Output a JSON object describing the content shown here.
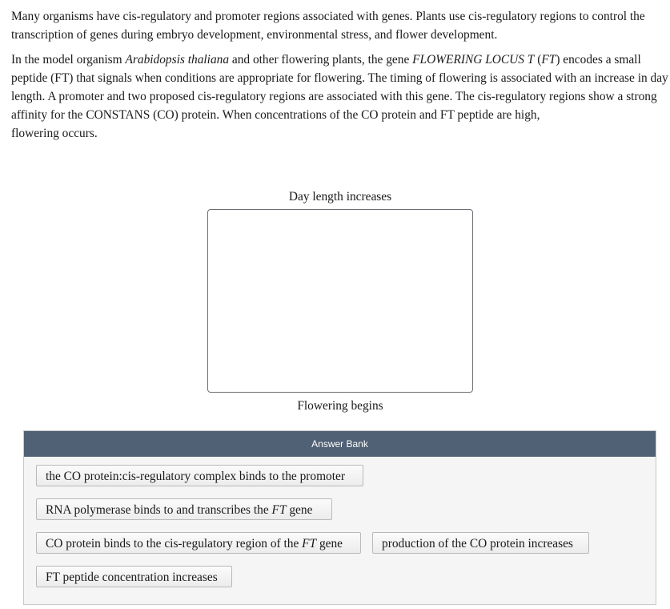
{
  "intro": {
    "paragraph1": "Many organisms have cis-regulatory and promoter regions associated with genes. Plants use cis-regulatory regions to control the transcription of genes during embryo development, environmental stress, and flower development.",
    "paragraph2": {
      "part1": "In the model organism ",
      "italic1": "Arabidopsis thaliana",
      "part2": " and other flowering plants, the gene ",
      "italic2": "FLOWERING LOCUS T",
      "part3": " (",
      "italic3": "FT",
      "part4": ") encodes a small peptide (FT) that signals when conditions are appropriate for flowering. The timing of flowering is associated with an increase in day length. A promoter and two proposed cis-regulatory regions are associated with this gene. The cis-regulatory regions show a strong affinity for the CONSTANS (CO) protein. When concentrations of the CO protein and FT peptide are high,",
      "part5": "flowering occurs."
    }
  },
  "sequence": {
    "start_label": "Day length increases",
    "end_label": "Flowering begins"
  },
  "answer_bank": {
    "title": "Answer Bank",
    "header_color": "#506075",
    "items": [
      {
        "pre": "the CO protein:cis-regulatory complex binds to the promoter",
        "italic": "",
        "post": ""
      },
      {
        "pre": "RNA polymerase binds to and transcribes the ",
        "italic": "FT",
        "post": " gene"
      },
      {
        "pre": "CO protein binds to the cis-regulatory region of the ",
        "italic": "FT",
        "post": " gene"
      },
      {
        "pre": "production of the CO protein increases",
        "italic": "",
        "post": ""
      },
      {
        "pre": "FT peptide concentration increases",
        "italic": "",
        "post": ""
      }
    ]
  }
}
